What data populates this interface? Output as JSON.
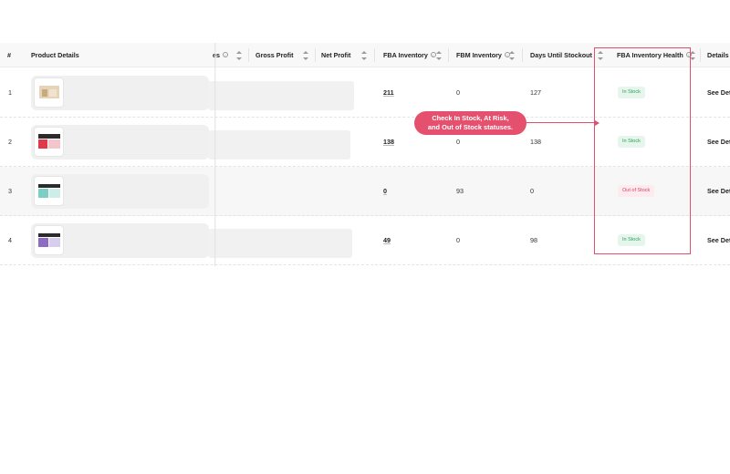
{
  "headers": {
    "index": "#",
    "product": "Product Details",
    "truncated": "es",
    "gross_profit": "Gross Profit",
    "net_profit": "Net Profit",
    "fba_inventory": "FBA Inventory",
    "fbm_inventory": "FBM Inventory",
    "days_until_stockout": "Days Until Stockout",
    "fba_health": "FBA Inventory Health",
    "details": "Details",
    "info_glyph": "i"
  },
  "rows": [
    {
      "index": "1",
      "fba": "211",
      "fbm": "0",
      "days": "127",
      "health": "In Stock",
      "details": "See Deta"
    },
    {
      "index": "2",
      "fba": "138",
      "fbm": "0",
      "days": "138",
      "health": "In Stock",
      "details": "See Deta"
    },
    {
      "index": "3",
      "fba": "0",
      "fbm": "93",
      "days": "0",
      "health": "Out of Stock",
      "details": "See Deta"
    },
    {
      "index": "4",
      "fba": "49",
      "fbm": "0",
      "days": "98",
      "health": "In Stock",
      "details": "See Deta"
    }
  ],
  "callout": {
    "line1": "Check In Stock, At Risk,",
    "line2": "and Out of Stock statuses."
  },
  "colors": {
    "accent": "#e5506f",
    "in_stock_bg": "#e6f6ec",
    "in_stock_text": "#2e9e5a",
    "out_stock_bg": "#fdebef",
    "out_stock_text": "#d93f5e"
  }
}
